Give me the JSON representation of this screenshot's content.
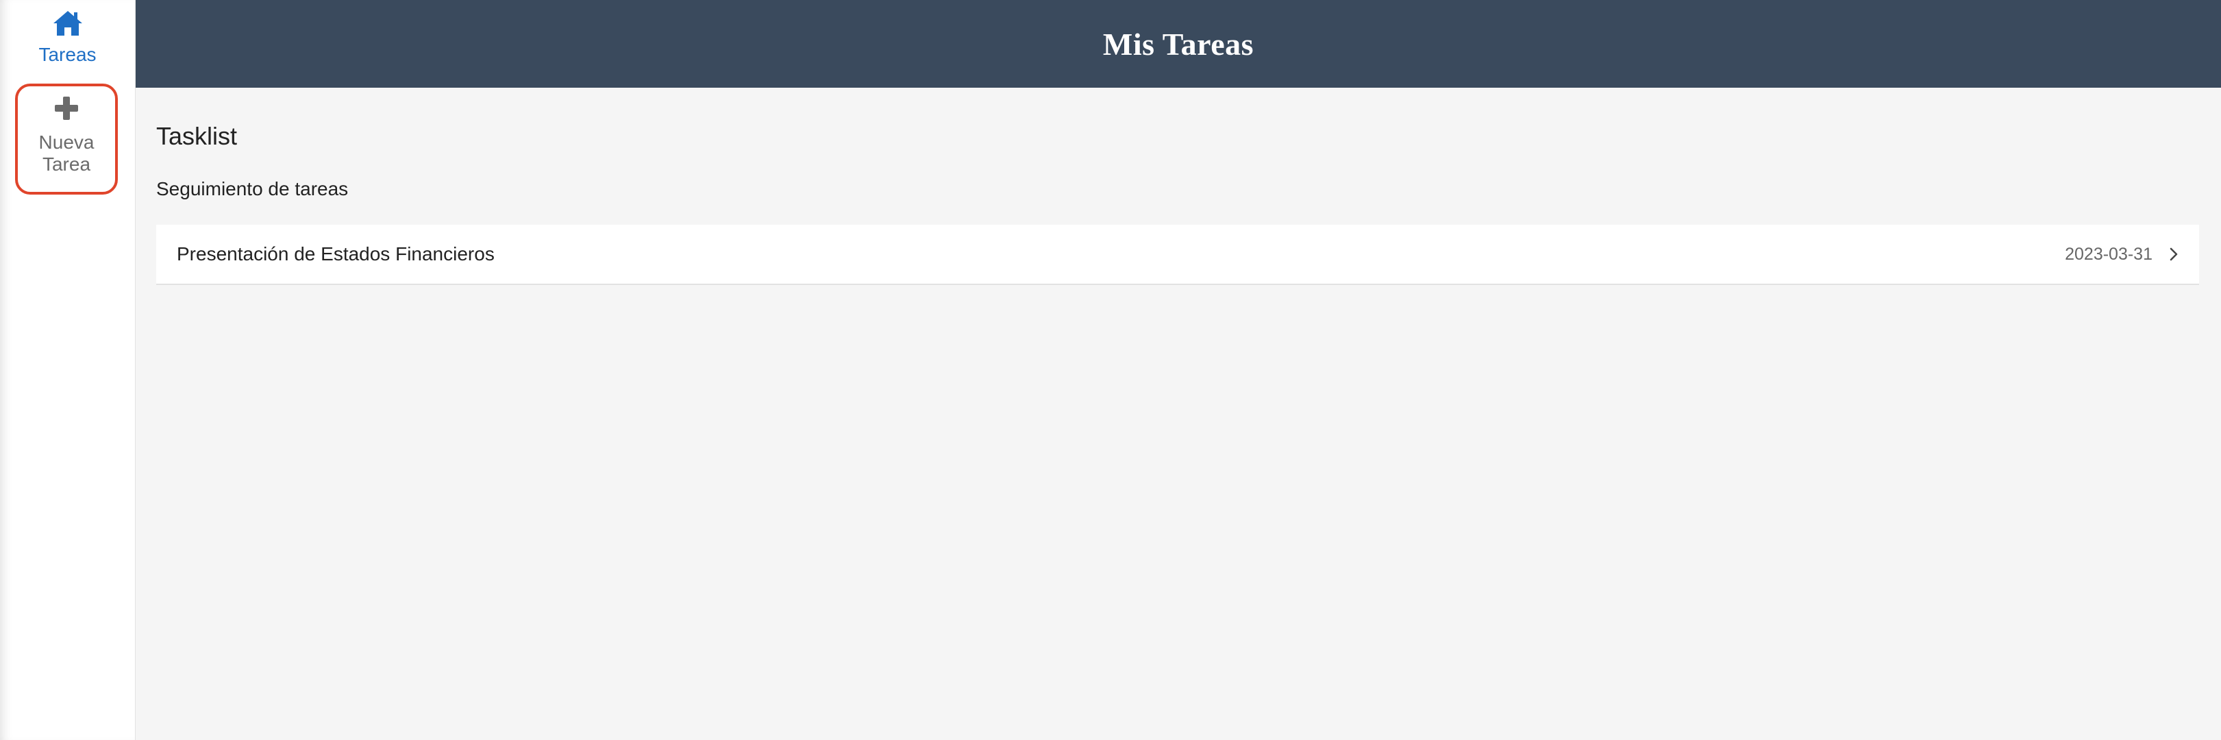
{
  "sidebar": {
    "items": [
      {
        "label": "Tareas",
        "icon": "home-icon",
        "active": true
      },
      {
        "label": "Nueva Tarea",
        "icon": "plus-icon",
        "active": false
      }
    ]
  },
  "header": {
    "title": "Mis Tareas"
  },
  "main": {
    "title": "Tasklist",
    "subtitle": "Seguimiento de tareas",
    "tasks": [
      {
        "title": "Presentación de Estados Financieros",
        "date": "2023-03-31"
      }
    ]
  },
  "colors": {
    "header_bg": "#3a4a5d",
    "accent": "#1f6fc5",
    "highlight_border": "#e0452b",
    "background": "#f5f5f5"
  }
}
